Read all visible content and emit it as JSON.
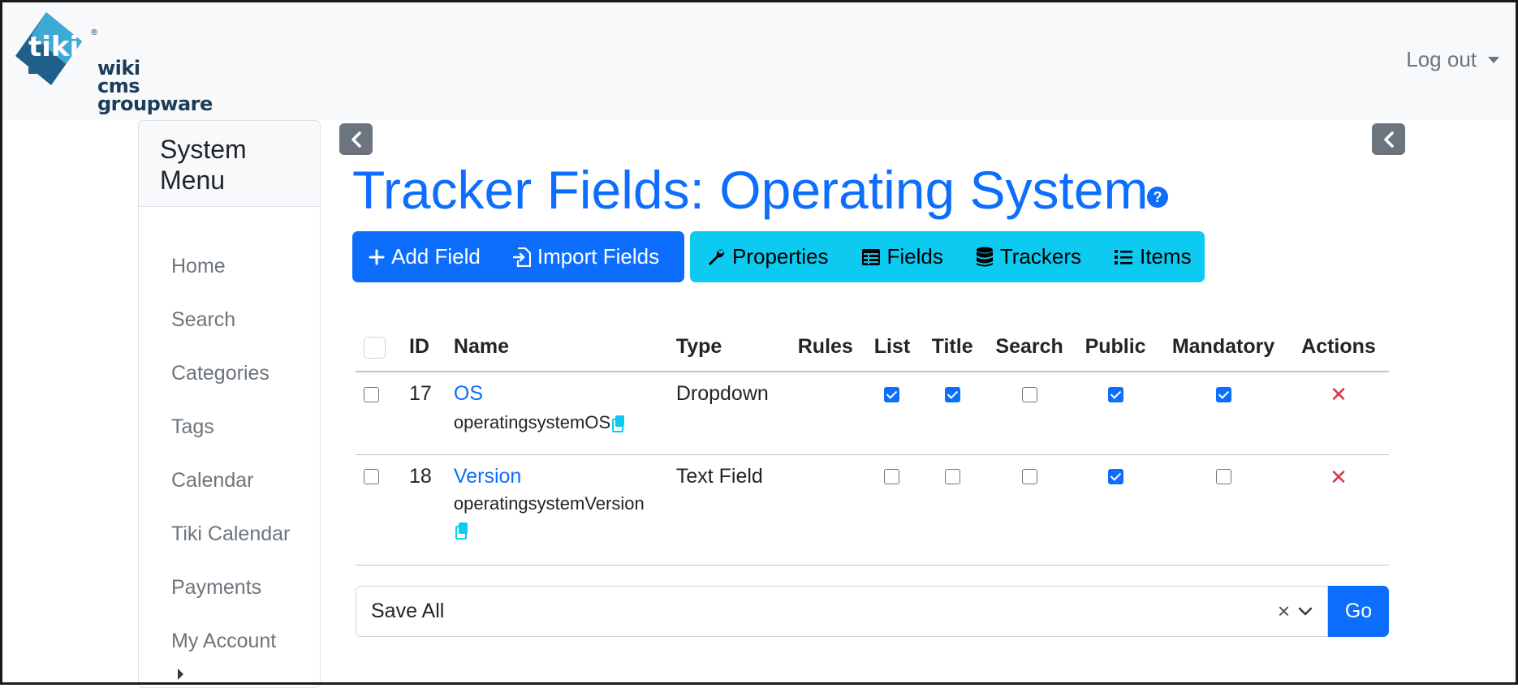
{
  "header": {
    "logo_mark": "tiki",
    "logo_lines": [
      "wiki",
      "cms",
      "groupware"
    ],
    "logout_label": "Log out"
  },
  "sidebar": {
    "title": "System Menu",
    "items": [
      {
        "label": "Home"
      },
      {
        "label": "Search"
      },
      {
        "label": "Categories"
      },
      {
        "label": "Tags"
      },
      {
        "label": "Calendar"
      },
      {
        "label": "Tiki Calendar"
      },
      {
        "label": "Payments"
      },
      {
        "label": "My Account"
      }
    ]
  },
  "page": {
    "title": "Tracker Fields: Operating System",
    "help_icon": "question-circle-icon"
  },
  "toolbar": {
    "primary": [
      {
        "label": "Add Field",
        "icon": "plus-icon"
      },
      {
        "label": "Import Fields",
        "icon": "import-icon"
      }
    ],
    "info": [
      {
        "label": "Properties",
        "icon": "wrench-icon"
      },
      {
        "label": "Fields",
        "icon": "table-icon"
      },
      {
        "label": "Trackers",
        "icon": "database-icon"
      },
      {
        "label": "Items",
        "icon": "list-icon"
      }
    ]
  },
  "table": {
    "headers": [
      "ID",
      "Name",
      "Type",
      "Rules",
      "List",
      "Title",
      "Search",
      "Public",
      "Mandatory",
      "Actions"
    ],
    "rows": [
      {
        "checked": false,
        "id": "17",
        "name": "OS",
        "perm_name": "operatingsystemOS",
        "type": "Dropdown",
        "rules": "",
        "list": true,
        "title": true,
        "search": false,
        "public": true,
        "mandatory": true
      },
      {
        "checked": false,
        "id": "18",
        "name": "Version",
        "perm_name": "operatingsystemVersion",
        "type": "Text Field",
        "rules": "",
        "list": false,
        "title": false,
        "search": false,
        "public": true,
        "mandatory": false
      }
    ]
  },
  "bulk": {
    "selected": "Save All",
    "clear": "×",
    "go_label": "Go"
  },
  "colors": {
    "primary": "#0d6efd",
    "info": "#0dcaf0",
    "danger": "#dc3545",
    "secondary": "#6c757d"
  }
}
